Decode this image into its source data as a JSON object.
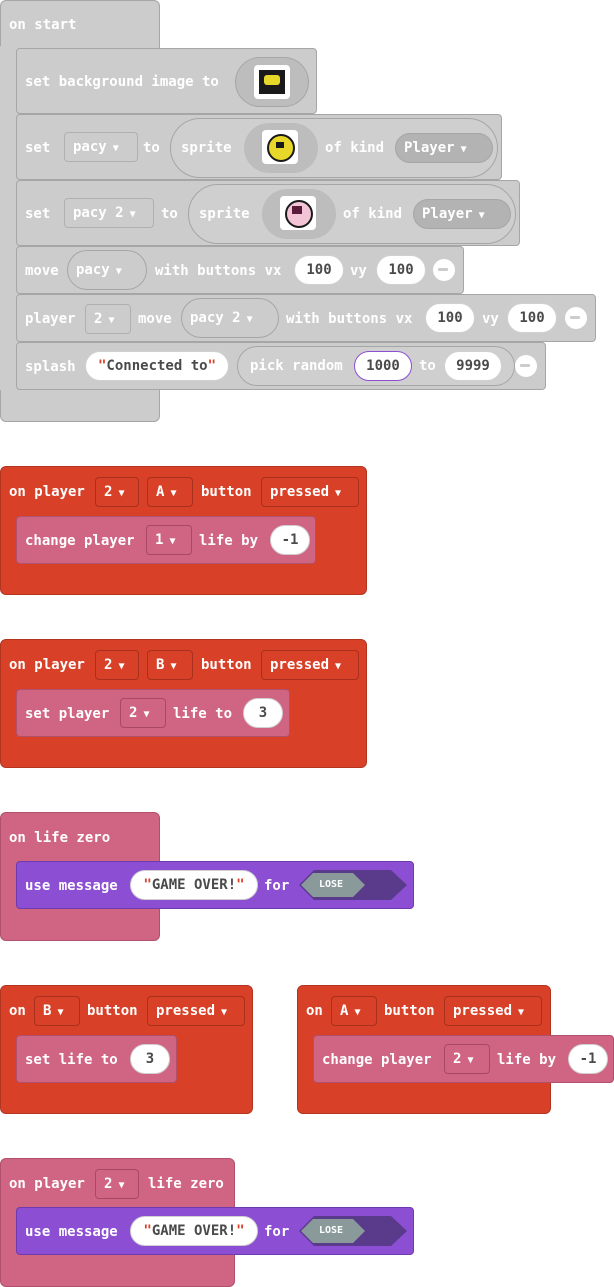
{
  "colors": {
    "loops_gray": "#cccccc",
    "controller_red": "#d84128",
    "info_pink": "#d06583",
    "game_purple": "#8c4fd3",
    "lose_gray": "#8a9a9a"
  },
  "on_start": {
    "hat": "on start",
    "set_bg": {
      "label": "set background image to"
    },
    "set_pacy": {
      "set": "set",
      "var": "pacy",
      "to": "to",
      "sprite": "sprite",
      "of_kind": "of kind",
      "kind": "Player"
    },
    "set_pacy2": {
      "set": "set",
      "var": "pacy 2",
      "to": "to",
      "sprite": "sprite",
      "of_kind": "of kind",
      "kind": "Player"
    },
    "move": {
      "move": "move",
      "var": "pacy",
      "with": "with buttons vx",
      "vx": "100",
      "vy_label": "vy",
      "vy": "100"
    },
    "player_move": {
      "player": "player",
      "num": "2",
      "move": "move",
      "var": "pacy 2",
      "with": "with buttons vx",
      "vx": "100",
      "vy_label": "vy",
      "vy": "100"
    },
    "splash": {
      "splash": "splash",
      "text": "Connected to",
      "pick": "pick random",
      "from": "1000",
      "to": "to",
      "max": "9999"
    }
  },
  "p2_a": {
    "hat": {
      "on_player": "on player",
      "player": "2",
      "button": "A",
      "button_label": "button",
      "event": "pressed"
    },
    "body": {
      "change": "change player",
      "player": "1",
      "life": "life by",
      "value": "-1"
    }
  },
  "p2_b": {
    "hat": {
      "on_player": "on player",
      "player": "2",
      "button": "B",
      "button_label": "button",
      "event": "pressed"
    },
    "body": {
      "set": "set player",
      "player": "2",
      "life": "life to",
      "value": "3"
    }
  },
  "life_zero": {
    "hat": "on life zero",
    "body": {
      "use": "use message",
      "message": "GAME OVER!",
      "for": "for",
      "effect": "LOSE"
    }
  },
  "b_pressed": {
    "hat": {
      "on": "on",
      "button": "B",
      "button_label": "button",
      "event": "pressed"
    },
    "body": {
      "set": "set life to",
      "value": "3"
    }
  },
  "a_pressed": {
    "hat": {
      "on": "on",
      "button": "A",
      "button_label": "button",
      "event": "pressed"
    },
    "body": {
      "change": "change player",
      "player": "2",
      "life": "life by",
      "value": "-1"
    }
  },
  "p2_life_zero": {
    "hat": {
      "on_player": "on player",
      "player": "2",
      "life_zero": "life zero"
    },
    "body": {
      "use": "use message",
      "message": "GAME OVER!",
      "for": "for",
      "effect": "LOSE"
    }
  }
}
